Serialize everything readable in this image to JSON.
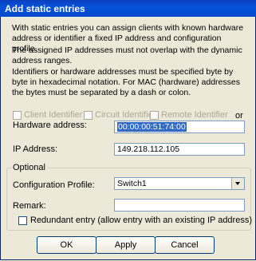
{
  "window": {
    "title": "Add static entries"
  },
  "intro": {
    "p1": "With static entries you can assign clients with known hardware address or identifier a fixed IP address and configuration profile.",
    "p2": "The assigned IP addresses must not overlap with the dynamic address ranges.",
    "p3": "Identifiers or hardware addresses must be specified byte by byte in hexadecimal notation. For MAC (hardware) addresses the bytes must be separated by a dash or colon."
  },
  "options": {
    "client_identifier": "Client Identifier",
    "circuit_identifier": "Circuit Identifier",
    "remote_identifier": "Remote Identifier",
    "or": "or"
  },
  "fields": {
    "hardware_address_label": "Hardware address:",
    "hardware_address_value": "00:00:00:51:74:00",
    "ip_address_label": "IP Address:",
    "ip_address_value": "149.218.112.105"
  },
  "optional": {
    "group_label": "Optional",
    "config_profile_label": "Configuration Profile:",
    "config_profile_value": "Switch1",
    "remark_label": "Remark:",
    "remark_value": "",
    "redundant_label": "Redundant entry (allow entry with an existing IP address)"
  },
  "buttons": {
    "ok": "OK",
    "apply": "Apply",
    "cancel": "Cancel"
  }
}
